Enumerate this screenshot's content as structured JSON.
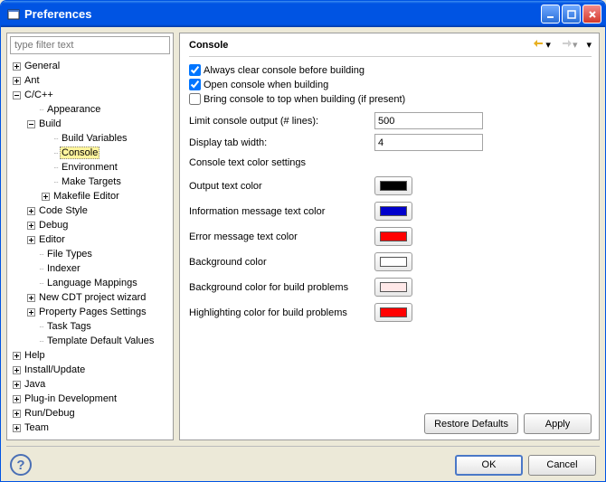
{
  "window": {
    "title": "Preferences"
  },
  "filter": {
    "placeholder": "type filter text"
  },
  "tree": [
    {
      "label": "General",
      "depth": 0,
      "exp": "plus"
    },
    {
      "label": "Ant",
      "depth": 0,
      "exp": "plus"
    },
    {
      "label": "C/C++",
      "depth": 0,
      "exp": "minus"
    },
    {
      "label": "Appearance",
      "depth": 1,
      "exp": "none"
    },
    {
      "label": "Build",
      "depth": 1,
      "exp": "minus"
    },
    {
      "label": "Build Variables",
      "depth": 2,
      "exp": "none"
    },
    {
      "label": "Console",
      "depth": 2,
      "exp": "none",
      "selected": true
    },
    {
      "label": "Environment",
      "depth": 2,
      "exp": "none"
    },
    {
      "label": "Make Targets",
      "depth": 2,
      "exp": "none"
    },
    {
      "label": "Makefile Editor",
      "depth": 2,
      "exp": "plus"
    },
    {
      "label": "Code Style",
      "depth": 1,
      "exp": "plus"
    },
    {
      "label": "Debug",
      "depth": 1,
      "exp": "plus"
    },
    {
      "label": "Editor",
      "depth": 1,
      "exp": "plus"
    },
    {
      "label": "File Types",
      "depth": 1,
      "exp": "none"
    },
    {
      "label": "Indexer",
      "depth": 1,
      "exp": "none"
    },
    {
      "label": "Language Mappings",
      "depth": 1,
      "exp": "none"
    },
    {
      "label": "New CDT project wizard",
      "depth": 1,
      "exp": "plus"
    },
    {
      "label": "Property Pages Settings",
      "depth": 1,
      "exp": "plus"
    },
    {
      "label": "Task Tags",
      "depth": 1,
      "exp": "none"
    },
    {
      "label": "Template Default Values",
      "depth": 1,
      "exp": "none"
    },
    {
      "label": "Help",
      "depth": 0,
      "exp": "plus"
    },
    {
      "label": "Install/Update",
      "depth": 0,
      "exp": "plus"
    },
    {
      "label": "Java",
      "depth": 0,
      "exp": "plus"
    },
    {
      "label": "Plug-in Development",
      "depth": 0,
      "exp": "plus"
    },
    {
      "label": "Run/Debug",
      "depth": 0,
      "exp": "plus"
    },
    {
      "label": "Team",
      "depth": 0,
      "exp": "plus"
    }
  ],
  "page": {
    "title": "Console",
    "checks": {
      "always_clear": {
        "label": "Always clear console before building",
        "checked": true
      },
      "open_console": {
        "label": "Open console when building",
        "checked": true
      },
      "bring_to_top": {
        "label": "Bring console to top when building (if present)",
        "checked": false
      }
    },
    "fields": {
      "limit_lines": {
        "label": "Limit console output (# lines):",
        "value": "500"
      },
      "tab_width": {
        "label": "Display tab width:",
        "value": "4"
      }
    },
    "color_section_label": "Console text color settings",
    "colors": {
      "output": {
        "label": "Output text color",
        "value": "#000000"
      },
      "info": {
        "label": "Information message text color",
        "value": "#0000cc"
      },
      "error": {
        "label": "Error message text color",
        "value": "#ff0000"
      },
      "background": {
        "label": "Background color",
        "value": "#ffffff"
      },
      "bg_problems": {
        "label": "Background color for build problems",
        "value": "#ffe8e8"
      },
      "hl_problems": {
        "label": "Highlighting color for build problems",
        "value": "#ff0000"
      }
    }
  },
  "buttons": {
    "restore_defaults": "Restore Defaults",
    "apply": "Apply",
    "ok": "OK",
    "cancel": "Cancel"
  }
}
